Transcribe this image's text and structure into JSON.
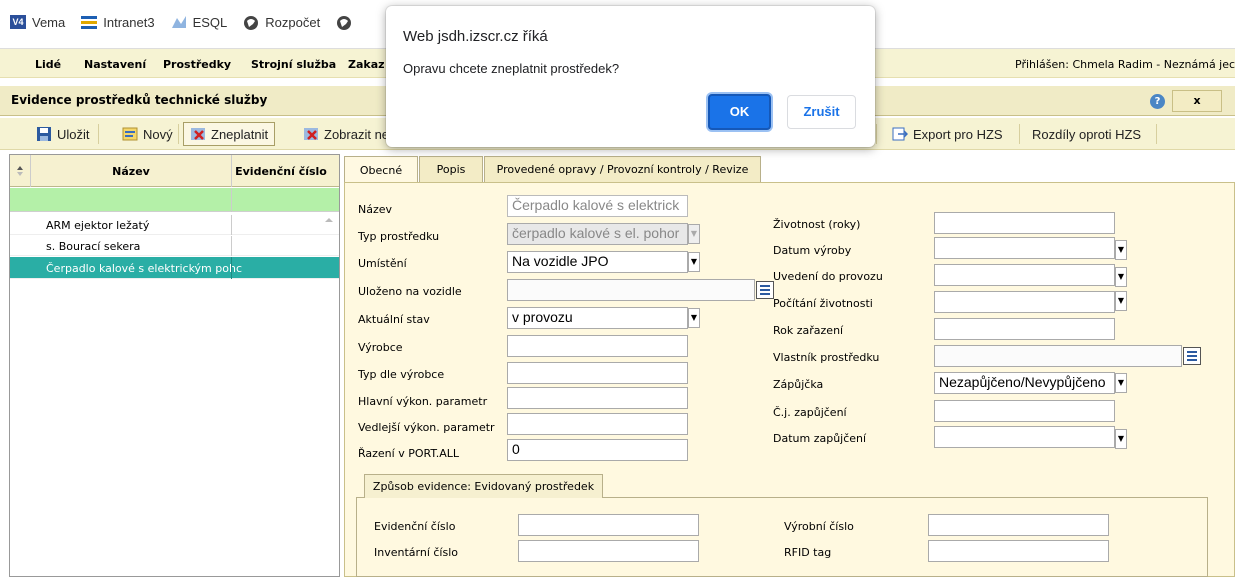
{
  "bookmarks": [
    {
      "label": "Vema",
      "icon": "vema-icon"
    },
    {
      "label": "Intranet3",
      "icon": "intranet-icon"
    },
    {
      "label": "ESQL",
      "icon": "esql-icon"
    },
    {
      "label": "Rozpočet",
      "icon": "globe-icon"
    }
  ],
  "menu": {
    "items": [
      "Lidé",
      "Nastavení",
      "Prostředky",
      "Strojní služba",
      "Zakaz"
    ],
    "user": "Přihlášen: Chmela Radim - Neznámá jec"
  },
  "header": {
    "title": "Evidence prostředků technické služby",
    "help": "?",
    "close": "x"
  },
  "toolbar": {
    "save": "Uložit",
    "new": "Nový",
    "invalidate": "Zneplatnit",
    "show": "Zobrazit ne",
    "export": "Export pro HZS",
    "diff": "Rozdíly oproti HZS"
  },
  "grid": {
    "columns": [
      "Název",
      "Evidenční číslo"
    ],
    "rows": [
      {
        "name": "ARM ejektor ležatý",
        "ev": ""
      },
      {
        "name": "s. Bourací sekera",
        "ev": ""
      },
      {
        "name": "Čerpadlo kalové s elektrickým pohc",
        "ev": ""
      }
    ],
    "selected_index": 2
  },
  "tabs": [
    "Obecné",
    "Popis",
    "Provedené opravy / Provozní kontroly / Revize"
  ],
  "form_left": {
    "nazev": {
      "label": "Název",
      "value": "Čerpadlo kalové s elektrick"
    },
    "typ": {
      "label": "Typ prostředku",
      "value": "čerpadlo kalové s el. pohor"
    },
    "umisteni": {
      "label": "Umístění",
      "value": "Na vozidle JPO"
    },
    "ulozeno": {
      "label": "Uloženo na vozidle",
      "value": ""
    },
    "stav": {
      "label": "Aktuální stav",
      "value": "v provozu"
    },
    "vyrobce": {
      "label": "Výrobce",
      "value": ""
    },
    "typ_vyrobce": {
      "label": "Typ dle výrobce",
      "value": ""
    },
    "hlavni": {
      "label": "Hlavní výkon. parametr",
      "value": ""
    },
    "vedlejsi": {
      "label": "Vedlejší výkon. parametr",
      "value": ""
    },
    "razeni": {
      "label": "Řazení v PORT.ALL",
      "value": "0"
    }
  },
  "form_right": {
    "zivotnost": {
      "label": "Životnost (roky)",
      "value": ""
    },
    "datum_vyroby": {
      "label": "Datum výroby",
      "value": ""
    },
    "uvedeni": {
      "label": "Uvedení do provozu",
      "value": ""
    },
    "pocitani": {
      "label": "Počítání životnosti",
      "value": ""
    },
    "rok": {
      "label": "Rok zařazení",
      "value": ""
    },
    "vlastnik": {
      "label": "Vlastník prostředku",
      "value": ""
    },
    "zapujcka": {
      "label": "Zápůjčka",
      "value": "Nezapůjčeno/Nevypůjčeno"
    },
    "cj": {
      "label": "Č.j. zapůjčení",
      "value": ""
    },
    "datum_zap": {
      "label": "Datum zapůjčení",
      "value": ""
    }
  },
  "evidence": {
    "tab": "Způsob evidence: Evidovaný prostředek",
    "ev_cislo": "Evidenční číslo",
    "inv_cislo": "Inventární číslo",
    "vyr_cislo": "Výrobní číslo",
    "rfid": "RFID tag"
  },
  "dialog": {
    "title": "Web jsdh.izscr.cz říká",
    "message": "Opravu chcete zneplatnit prostředek?",
    "ok": "OK",
    "cancel": "Zrušit"
  },
  "colors": {
    "accent_teal": "#2aaea5",
    "menu_bg": "#f6f3d3",
    "dialog_ok": "#1a73e8"
  }
}
